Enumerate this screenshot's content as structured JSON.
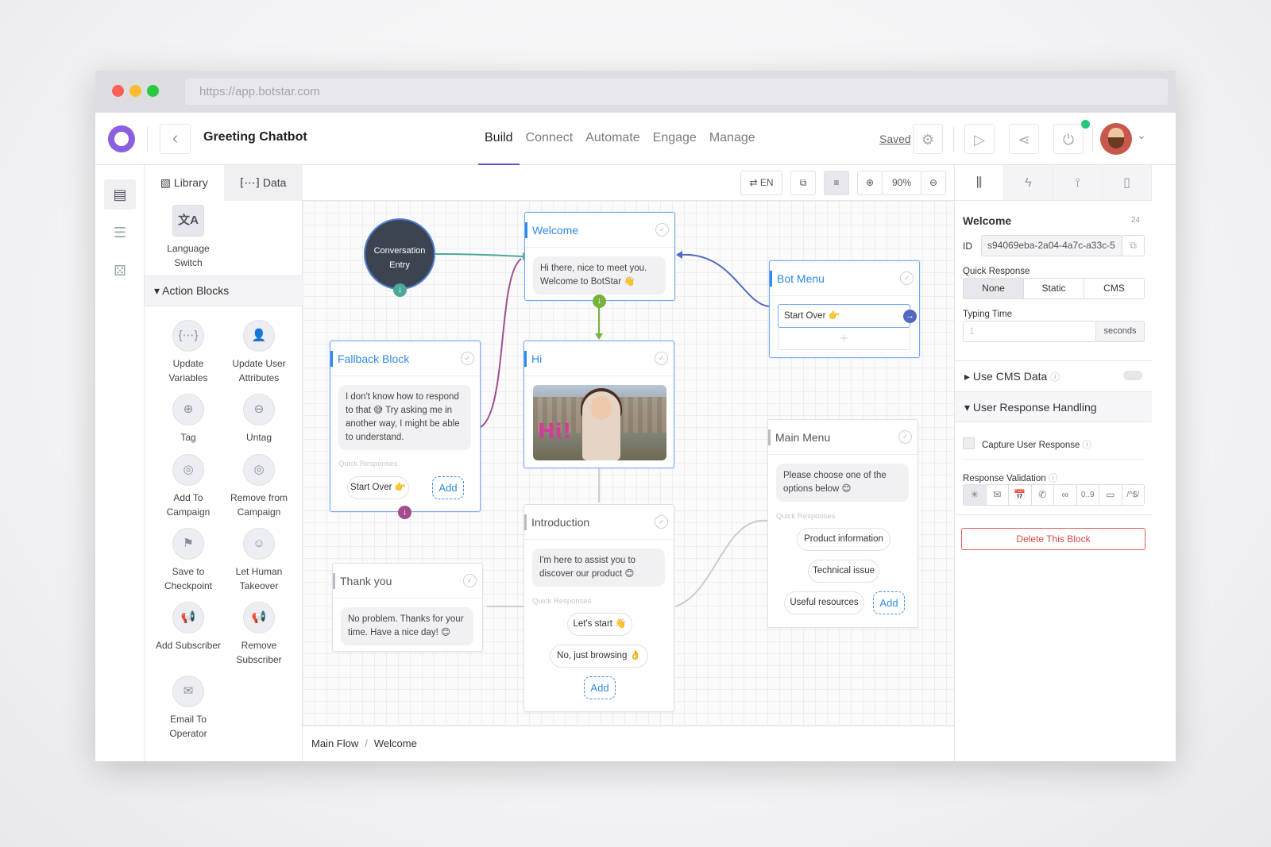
{
  "browser": {
    "url": "https://app.botstar.com"
  },
  "header": {
    "title": "Greeting Chatbot",
    "nav": [
      "Build",
      "Connect",
      "Automate",
      "Engage",
      "Manage"
    ],
    "saved": "Saved"
  },
  "library": {
    "tabs": [
      "Library",
      "Data"
    ],
    "language_switch": "Language Switch",
    "section": "Action Blocks",
    "tiles": [
      "Update Variables",
      "Update User Attributes",
      "Tag",
      "Untag",
      "Add To Campaign",
      "Remove from Campaign",
      "Save to Checkpoint",
      "Let Human Takeover",
      "Add Subscriber",
      "Remove Subscriber",
      "Email To Operator"
    ]
  },
  "canvas": {
    "language": "EN",
    "zoom": "90%",
    "entry": "Conversation Entry",
    "blocks": {
      "welcome": {
        "title": "Welcome",
        "message": "Hi there, nice to meet you. Welcome to BotStar 👋"
      },
      "bot_menu": {
        "title": "Bot Menu",
        "button": "Start Over 👉"
      },
      "fallback": {
        "title": "Fallback Block",
        "message": "I don't know how to respond to that 😅  Try asking me in another way, I might be able to understand.",
        "qr_label": "Quick Responses",
        "button": "Start Over 👉",
        "add": "Add"
      },
      "hi": {
        "title": "Hi",
        "image_text": "Hi!"
      },
      "main_menu": {
        "title": "Main Menu",
        "message": "Please choose one of the options below 😊",
        "qr_label": "Quick Responses",
        "options": [
          "Product information",
          "Technical issue",
          "Useful resources"
        ],
        "add": "Add"
      },
      "introduction": {
        "title": "Introduction",
        "message": "I'm here to assist you to discover our product 😊",
        "qr_label": "Quick Responses",
        "options": [
          "Let's start 👋",
          "No, just browsing 👌"
        ],
        "add": "Add"
      },
      "thank_you": {
        "title": "Thank you",
        "message": "No problem. Thanks for your time. Have a nice day! 😊"
      }
    },
    "breadcrumb": [
      "Main Flow",
      "Welcome"
    ]
  },
  "properties": {
    "block_name": "Welcome",
    "char_count": "24",
    "id_label": "ID",
    "id_value": "s94069eba-2a04-4a7c-a33c-5",
    "quick_response_label": "Quick Response",
    "quick_response_options": [
      "None",
      "Static",
      "CMS"
    ],
    "typing_time_label": "Typing Time",
    "typing_time_placeholder": "1",
    "typing_time_unit": "seconds",
    "use_cms": "Use CMS Data",
    "user_response": "User Response Handling",
    "capture": "Capture User Response",
    "validation_label": "Response Validation",
    "validation_options": [
      "✳",
      "✉",
      "📅",
      "✆",
      "∞",
      "0..9",
      "▭",
      "/^$/"
    ],
    "delete": "Delete This Block"
  }
}
